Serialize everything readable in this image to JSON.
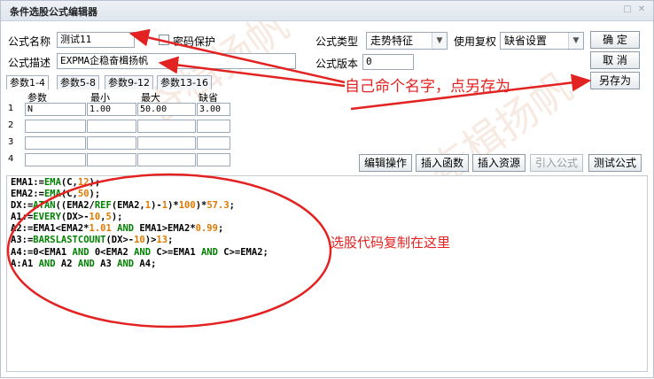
{
  "window": {
    "title": "条件选股公式编辑器",
    "controls": [
      "□",
      "✕"
    ]
  },
  "form": {
    "name_label": "公式名称",
    "name_value": "测试11",
    "password_label": "密码保护",
    "desc_label": "公式描述",
    "desc_value": "EXPMA企稳奋楫扬帆",
    "type_label": "公式类型",
    "type_value": "走势特征",
    "rights_label": "使用复权",
    "rights_value": "缺省设置",
    "version_label": "公式版本",
    "version_value": "0"
  },
  "buttons": {
    "ok": "确  定",
    "cancel": "取  消",
    "save_as": "另存为",
    "edit_ops": "编辑操作",
    "insert_func": "插入函数",
    "insert_res": "插入资源",
    "import_formula": "引入公式",
    "test_formula": "测试公式"
  },
  "param_tabs": [
    "参数1-4",
    "参数5-8",
    "参数9-12",
    "参数13-16"
  ],
  "param_headers": [
    "参数",
    "最小",
    "最大",
    "缺省"
  ],
  "params": [
    {
      "row": "1",
      "name": "N",
      "min": "1.00",
      "max": "50.00",
      "default": "3.00"
    },
    {
      "row": "2",
      "name": "",
      "min": "",
      "max": "",
      "default": ""
    },
    {
      "row": "3",
      "name": "",
      "min": "",
      "max": "",
      "default": ""
    },
    {
      "row": "4",
      "name": "",
      "min": "",
      "max": "",
      "default": ""
    }
  ],
  "code_lines": [
    [
      [
        "n",
        "EMA1:="
      ],
      [
        "f",
        "EMA"
      ],
      [
        "n",
        "(C,"
      ],
      [
        "num",
        "12"
      ],
      [
        "n",
        ");"
      ]
    ],
    [
      [
        "n",
        "EMA2:="
      ],
      [
        "f",
        "EMA"
      ],
      [
        "n",
        "(C,"
      ],
      [
        "num",
        "50"
      ],
      [
        "n",
        ");"
      ]
    ],
    [
      [
        "n",
        "DX:="
      ],
      [
        "f",
        "ATAN"
      ],
      [
        "n",
        "((EMA2/"
      ],
      [
        "f",
        "REF"
      ],
      [
        "n",
        "(EMA2,"
      ],
      [
        "num",
        "1"
      ],
      [
        "n",
        ")-"
      ],
      [
        "num",
        "1"
      ],
      [
        "n",
        ")*"
      ],
      [
        "num",
        "100"
      ],
      [
        "n",
        ")*"
      ],
      [
        "num",
        "57.3"
      ],
      [
        "n",
        ";"
      ]
    ],
    [
      [
        "n",
        "A1:="
      ],
      [
        "f",
        "EVERY"
      ],
      [
        "n",
        "(DX>-"
      ],
      [
        "num",
        "10"
      ],
      [
        "n",
        ","
      ],
      [
        "num",
        "5"
      ],
      [
        "n",
        ");"
      ]
    ],
    [
      [
        "n",
        "A2:=EMA1<EMA2*"
      ],
      [
        "num",
        "1.01"
      ],
      [
        "n",
        " "
      ],
      [
        "k",
        "AND"
      ],
      [
        "n",
        " EMA1>EMA2*"
      ],
      [
        "num",
        "0.99"
      ],
      [
        "n",
        ";"
      ]
    ],
    [
      [
        "n",
        "A3:="
      ],
      [
        "f",
        "BARSLASTCOUNT"
      ],
      [
        "n",
        "(DX>-"
      ],
      [
        "num",
        "10"
      ],
      [
        "n",
        ")>"
      ],
      [
        "num",
        "13"
      ],
      [
        "n",
        ";"
      ]
    ],
    [
      [
        "n",
        "A4:=0<EMA1 "
      ],
      [
        "k",
        "AND"
      ],
      [
        "n",
        " 0<EMA2 "
      ],
      [
        "k",
        "AND"
      ],
      [
        "n",
        " C>=EMA1 "
      ],
      [
        "k",
        "AND"
      ],
      [
        "n",
        " C>=EMA2;"
      ]
    ],
    [
      [
        "n",
        "A:A1 "
      ],
      [
        "k",
        "AND"
      ],
      [
        "n",
        " A2 "
      ],
      [
        "k",
        "AND"
      ],
      [
        "n",
        " A3 "
      ],
      [
        "k",
        "AND"
      ],
      [
        "n",
        " A4;"
      ]
    ]
  ],
  "annotations": {
    "rename": "自己命个名字，点另存为",
    "paste_code": "选股代码复制在这里"
  },
  "watermark": "奋楫扬帆",
  "colors": {
    "annotation": "#e32222",
    "function": "#008000",
    "number": "#e07800"
  }
}
